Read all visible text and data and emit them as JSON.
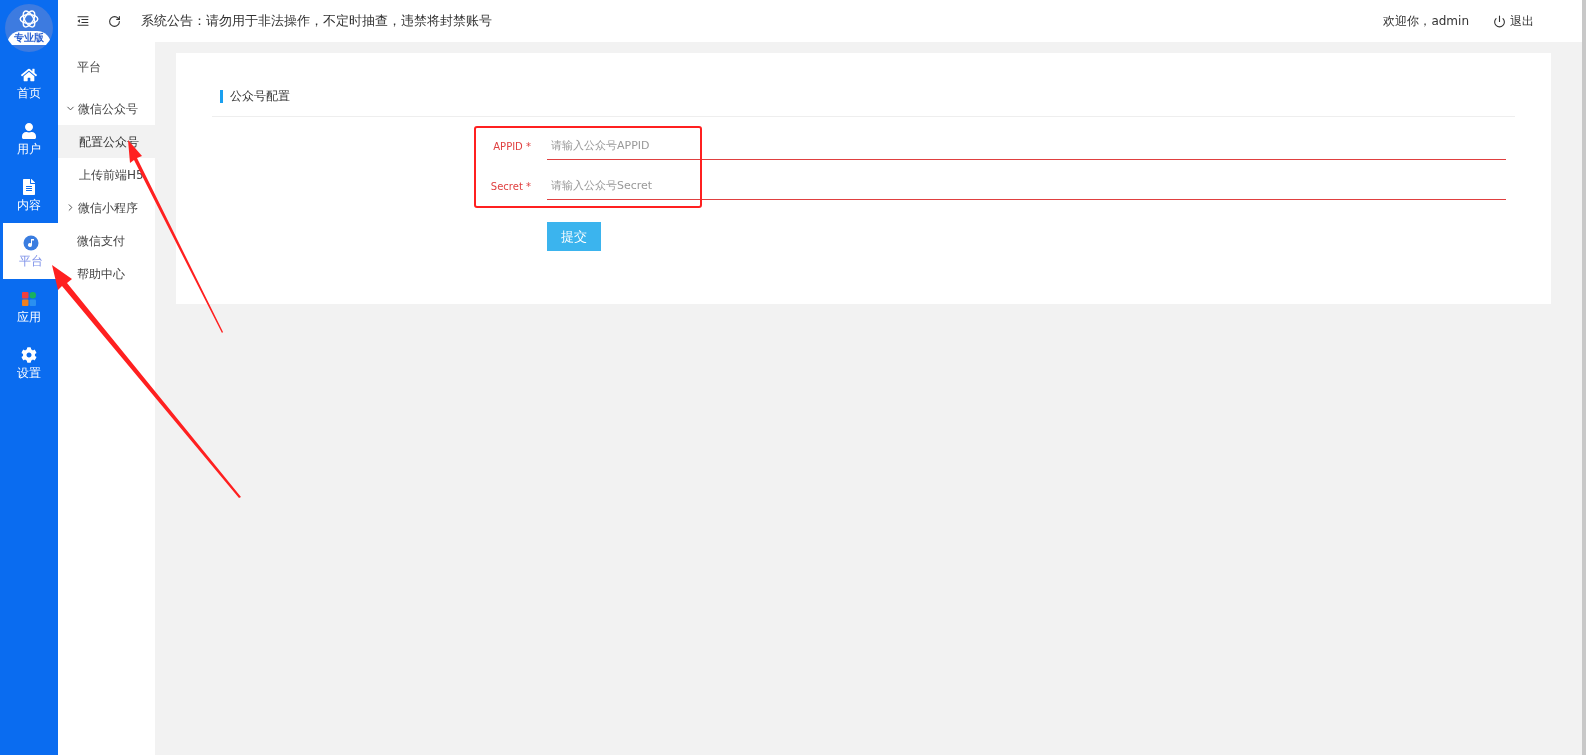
{
  "rail": {
    "logo_badge": "专业版",
    "items": [
      {
        "label": "首页",
        "kind": "home",
        "selected": false
      },
      {
        "label": "用户",
        "kind": "user",
        "selected": false
      },
      {
        "label": "内容",
        "kind": "content",
        "selected": false
      },
      {
        "label": "平台",
        "kind": "platform",
        "selected": true
      },
      {
        "label": "应用",
        "kind": "apps",
        "selected": false
      },
      {
        "label": "设置",
        "kind": "settings",
        "selected": false
      }
    ]
  },
  "topbar": {
    "notice": "系统公告：请勿用于非法操作，不定时抽查，违禁将封禁账号",
    "welcome": "欢迎你，admin",
    "logout": "退出"
  },
  "submenu": {
    "title": "平台",
    "items": [
      {
        "label": "微信公众号",
        "kind": "group",
        "expanded": true,
        "children": [
          {
            "label": "配置公众号",
            "selected": true
          },
          {
            "label": "上传前端H5",
            "selected": false
          }
        ]
      },
      {
        "label": "微信小程序",
        "kind": "group",
        "expanded": false
      },
      {
        "label": "微信支付",
        "kind": "link",
        "selected": false
      },
      {
        "label": "帮助中心",
        "kind": "link",
        "selected": false
      }
    ]
  },
  "card": {
    "title": "公众号配置",
    "fields": [
      {
        "label": "APPID *",
        "error": true,
        "placeholder": "请输入公众号APPID"
      },
      {
        "label": "Secret *",
        "error": true,
        "placeholder": "请输入公众号Secret"
      }
    ],
    "submit": "提交"
  }
}
